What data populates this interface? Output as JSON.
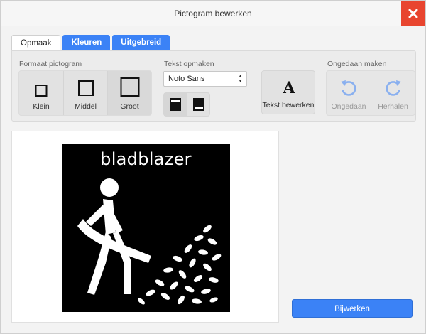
{
  "window": {
    "title": "Pictogram bewerken"
  },
  "tabs": [
    {
      "label": "Opmaak",
      "active": true
    },
    {
      "label": "Kleuren",
      "active": false
    },
    {
      "label": "Uitgebreid",
      "active": false
    }
  ],
  "toolbar": {
    "format": {
      "label": "Formaat pictogram",
      "options": [
        {
          "label": "Klein"
        },
        {
          "label": "Middel"
        },
        {
          "label": "Groot"
        }
      ],
      "selected": "Groot"
    },
    "text": {
      "label": "Tekst opmaken",
      "font_value": "Noto Sans",
      "position_options": [
        "text-top",
        "text-bottom"
      ],
      "selected_position": "text-top",
      "edit_label": "Tekst bewerken"
    },
    "undo": {
      "label": "Ongedaan maken",
      "undo_label": "Ongedaan",
      "redo_label": "Herhalen"
    }
  },
  "preview": {
    "caption": "bladblazer",
    "icon": "leaf-blower-person-icon"
  },
  "submit_label": "Bijwerken",
  "colors": {
    "accent": "#3b82f6",
    "close": "#e8452f",
    "undo_icon": "#8ab0ef"
  }
}
